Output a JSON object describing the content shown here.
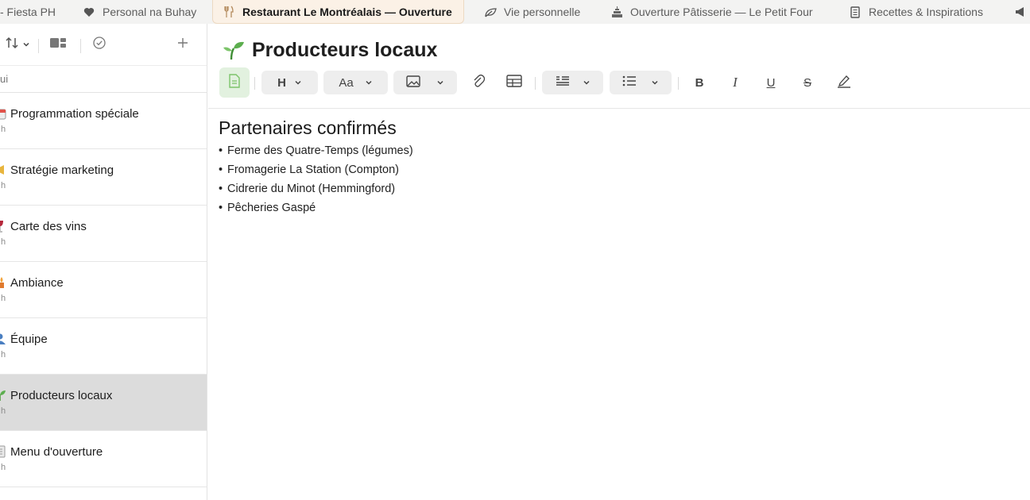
{
  "tabs": [
    {
      "label": "- Fiesta PH",
      "icon": "none"
    },
    {
      "label": "Personal na Buhay",
      "icon": "heart-icon"
    },
    {
      "label": "Restaurant Le Montréalais — Ouverture",
      "icon": "fork-knife-icon",
      "active": true
    },
    {
      "label": "Vie personnelle",
      "icon": "leaf-icon"
    },
    {
      "label": "Ouverture Pâtisserie — Le Petit Four",
      "icon": "cake-icon"
    },
    {
      "label": "Recettes & Inspirations",
      "icon": "notebook-icon"
    }
  ],
  "sidebar": {
    "search_text": "ui",
    "notes": [
      {
        "title": "Programmation spéciale",
        "meta": "h",
        "icon": "calendar-icon"
      },
      {
        "title": "Stratégie marketing",
        "meta": "h",
        "icon": "megaphone-icon"
      },
      {
        "title": "Carte des vins",
        "meta": "h",
        "icon": "wine-icon"
      },
      {
        "title": "Ambiance",
        "meta": "h",
        "icon": "candle-icon"
      },
      {
        "title": "Équipe",
        "meta": "h",
        "icon": "people-icon"
      },
      {
        "title": "Producteurs locaux",
        "meta": "h",
        "icon": "sprout-icon",
        "selected": true
      },
      {
        "title": "Menu d'ouverture",
        "meta": "h",
        "icon": "menu-icon"
      }
    ]
  },
  "editor": {
    "title": "Producteurs locaux",
    "title_icon": "sprout-icon",
    "toolbar": {
      "heading_label": "H",
      "font_label": "Aa",
      "bold_label": "B",
      "italic_label": "I",
      "underline_label": "U",
      "strike_label": "S"
    },
    "heading": "Partenaires confirmés",
    "bullets": [
      "Ferme des Quatre-Temps (légumes)",
      "Fromagerie La Station (Compton)",
      "Cidrerie du Minot (Hemmingford)",
      "Pêcheries Gaspé"
    ]
  },
  "colors": {
    "active_tab_bg": "#fbf1e6",
    "selected_note_bg": "#dcdcdc",
    "accent_green": "#5cae4e"
  }
}
